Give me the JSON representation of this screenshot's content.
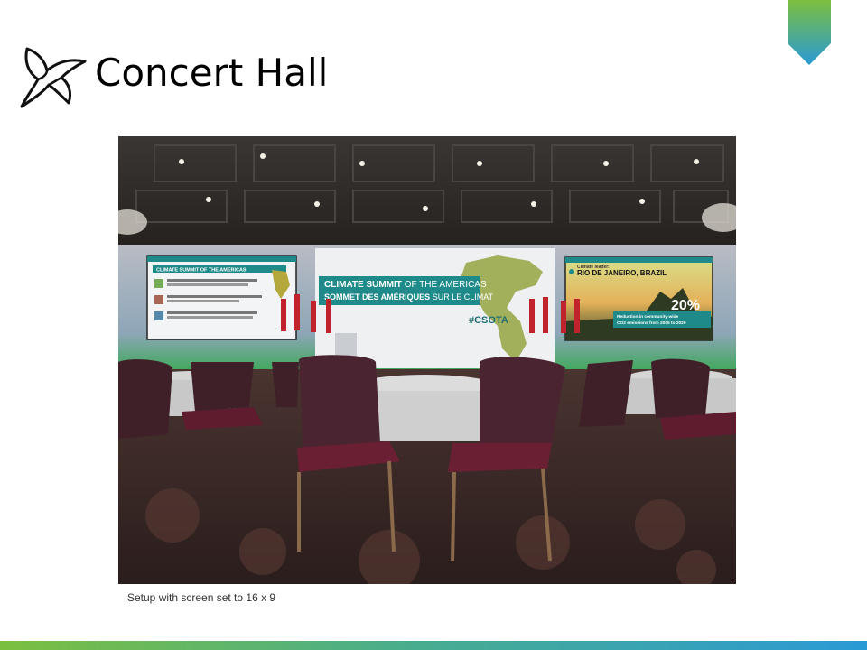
{
  "slide": {
    "title": "Concert Hall",
    "caption": "Setup with screen set to 16 x 9",
    "logo_icon": "trillium-logo-icon",
    "corner_icon": "corner-tab-icon"
  },
  "photo": {
    "center_screen": {
      "line1_a": "CLIMATE SUMMIT",
      "line1_b": "OF THE AMERICAS",
      "line2_a": "SOMMET DES AMÉRIQUES",
      "line2_b": "SUR LE CLIMAT",
      "hashtag": "#CSOTA"
    },
    "left_screen": {
      "banner": "CLIMATE SUMMIT OF THE AMERICAS"
    },
    "right_screen": {
      "label": "Climate leader:",
      "city": "RIO DE JANEIRO, BRAZIL",
      "stat": "20%",
      "detail_1": "Reduction in community-wide",
      "detail_2": "CO2 emissions from 2005 to 2020"
    }
  },
  "colors": {
    "accent_green": "#7cbf3f",
    "accent_blue": "#2a9ad6",
    "screen_teal": "#1f8a8a"
  }
}
